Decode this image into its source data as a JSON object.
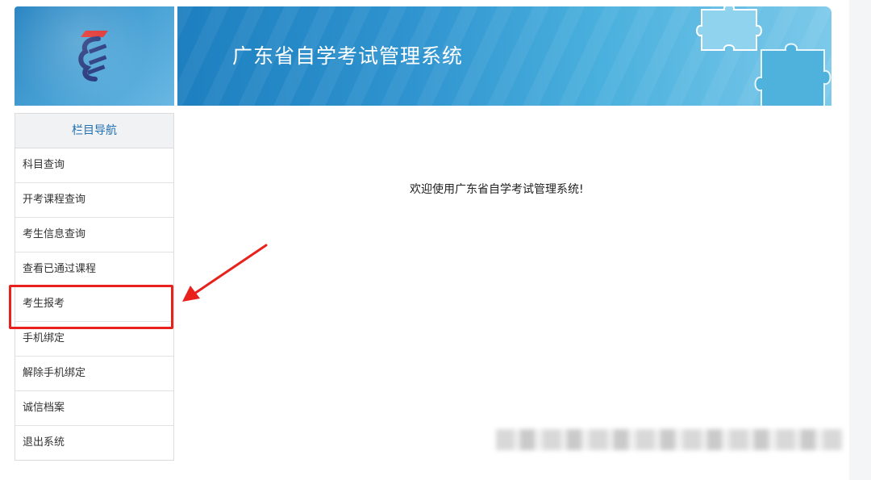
{
  "header": {
    "system_title": "广东省自学考试管理系统"
  },
  "sidebar": {
    "header_label": "栏目导航",
    "items": [
      {
        "label": "科目查询"
      },
      {
        "label": "开考课程查询"
      },
      {
        "label": "考生信息查询"
      },
      {
        "label": "查看已通过课程"
      },
      {
        "label": "考生报考"
      },
      {
        "label": "手机绑定"
      },
      {
        "label": "解除手机绑定"
      },
      {
        "label": "诚信档案"
      },
      {
        "label": "退出系统"
      }
    ]
  },
  "main": {
    "welcome_text": "欢迎使用广东省自学考试管理系统!"
  },
  "annotation": {
    "highlighted_item": "考生报考",
    "color": "#e8211d"
  },
  "colors": {
    "banner_blue": "#2f93cf",
    "nav_header_text": "#1f6fb2"
  }
}
